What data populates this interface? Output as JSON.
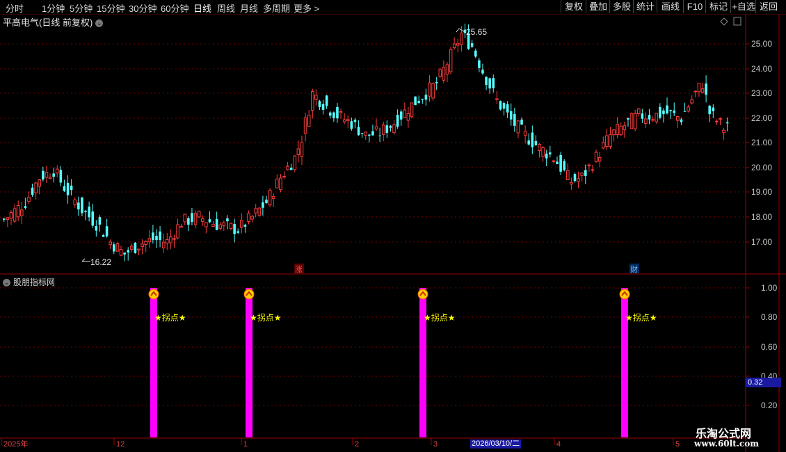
{
  "toolbar": {
    "periods": [
      "分时",
      "1分钟",
      "5分钟",
      "15分钟",
      "30分钟",
      "60分钟",
      "日线",
      "周线",
      "月线",
      "多周期",
      "更多 >"
    ],
    "active_period": "日线",
    "right_buttons": [
      "复权",
      "叠加",
      "多股",
      "统计",
      "画线",
      "F10",
      "标记",
      "+自选",
      "返回"
    ]
  },
  "main": {
    "title": "平高电气(日线 前复权)",
    "y_labels": [
      "25.00",
      "24.00",
      "23.00",
      "22.00",
      "21.00",
      "20.00",
      "19.00",
      "18.00",
      "17.00"
    ],
    "high_label": "25.65",
    "low_label": "16.22",
    "markers": {
      "zhang": "涨",
      "cai": "财"
    }
  },
  "indicator": {
    "title": "股朋指标网",
    "y_labels": [
      "1.00",
      "0.80",
      "0.60",
      "0.40",
      "0.20"
    ],
    "current_value": "0.32",
    "signal_label": "★拐点★"
  },
  "date_axis": {
    "labels": [
      "2025年",
      "12",
      "1",
      "2",
      "3",
      "4",
      "5"
    ],
    "cursor_date": "2026/03/10/二"
  },
  "watermark": {
    "name": "乐淘公式网",
    "url": "www.60lt.com"
  },
  "colors": {
    "up": "#ff3c3c",
    "down": "#54ffff",
    "signal": "#ff00ff",
    "grid": "#7a0000",
    "axis": "#a00000"
  },
  "chart_data": {
    "type": "candlestick",
    "price_range": [
      16.22,
      25.65
    ],
    "signal_values": [
      1,
      1,
      1,
      1
    ]
  }
}
